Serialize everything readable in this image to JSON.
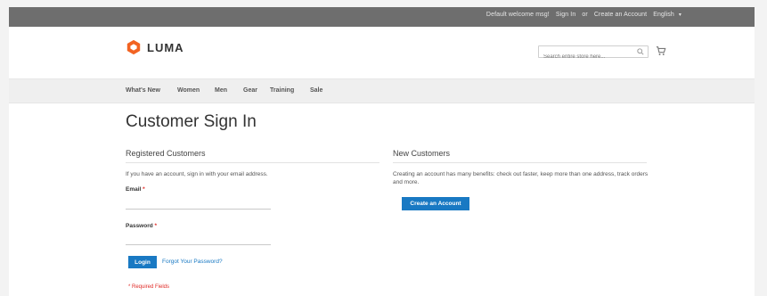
{
  "header": {
    "welcome": "Default welcome msg!",
    "sign_in": "Sign In",
    "or": "or",
    "create_account": "Create an Account",
    "language": "English"
  },
  "logo": {
    "text": "LUMA"
  },
  "search": {
    "placeholder": "Search entire store here..."
  },
  "nav": {
    "items": [
      "What's New",
      "Women",
      "Men",
      "Gear",
      "Training",
      "Sale"
    ]
  },
  "page": {
    "title": "Customer Sign In"
  },
  "registered": {
    "title": "Registered Customers",
    "intro": "If you have an account, sign in with your email address.",
    "email_label": "Email",
    "password_label": "Password",
    "required_mark": "*",
    "login_button": "Login",
    "forgot_link": "Forgot Your Password?",
    "required_note": "* Required Fields"
  },
  "new_customers": {
    "title": "New Customers",
    "text": "Creating an account has many benefits: check out faster, keep more than one address, track orders and more.",
    "create_button": "Create an Account"
  },
  "colors": {
    "topbar": "#6e6e6e",
    "accent": "#1979c3",
    "logo_orange": "#f26322",
    "required": "#e02b27"
  }
}
